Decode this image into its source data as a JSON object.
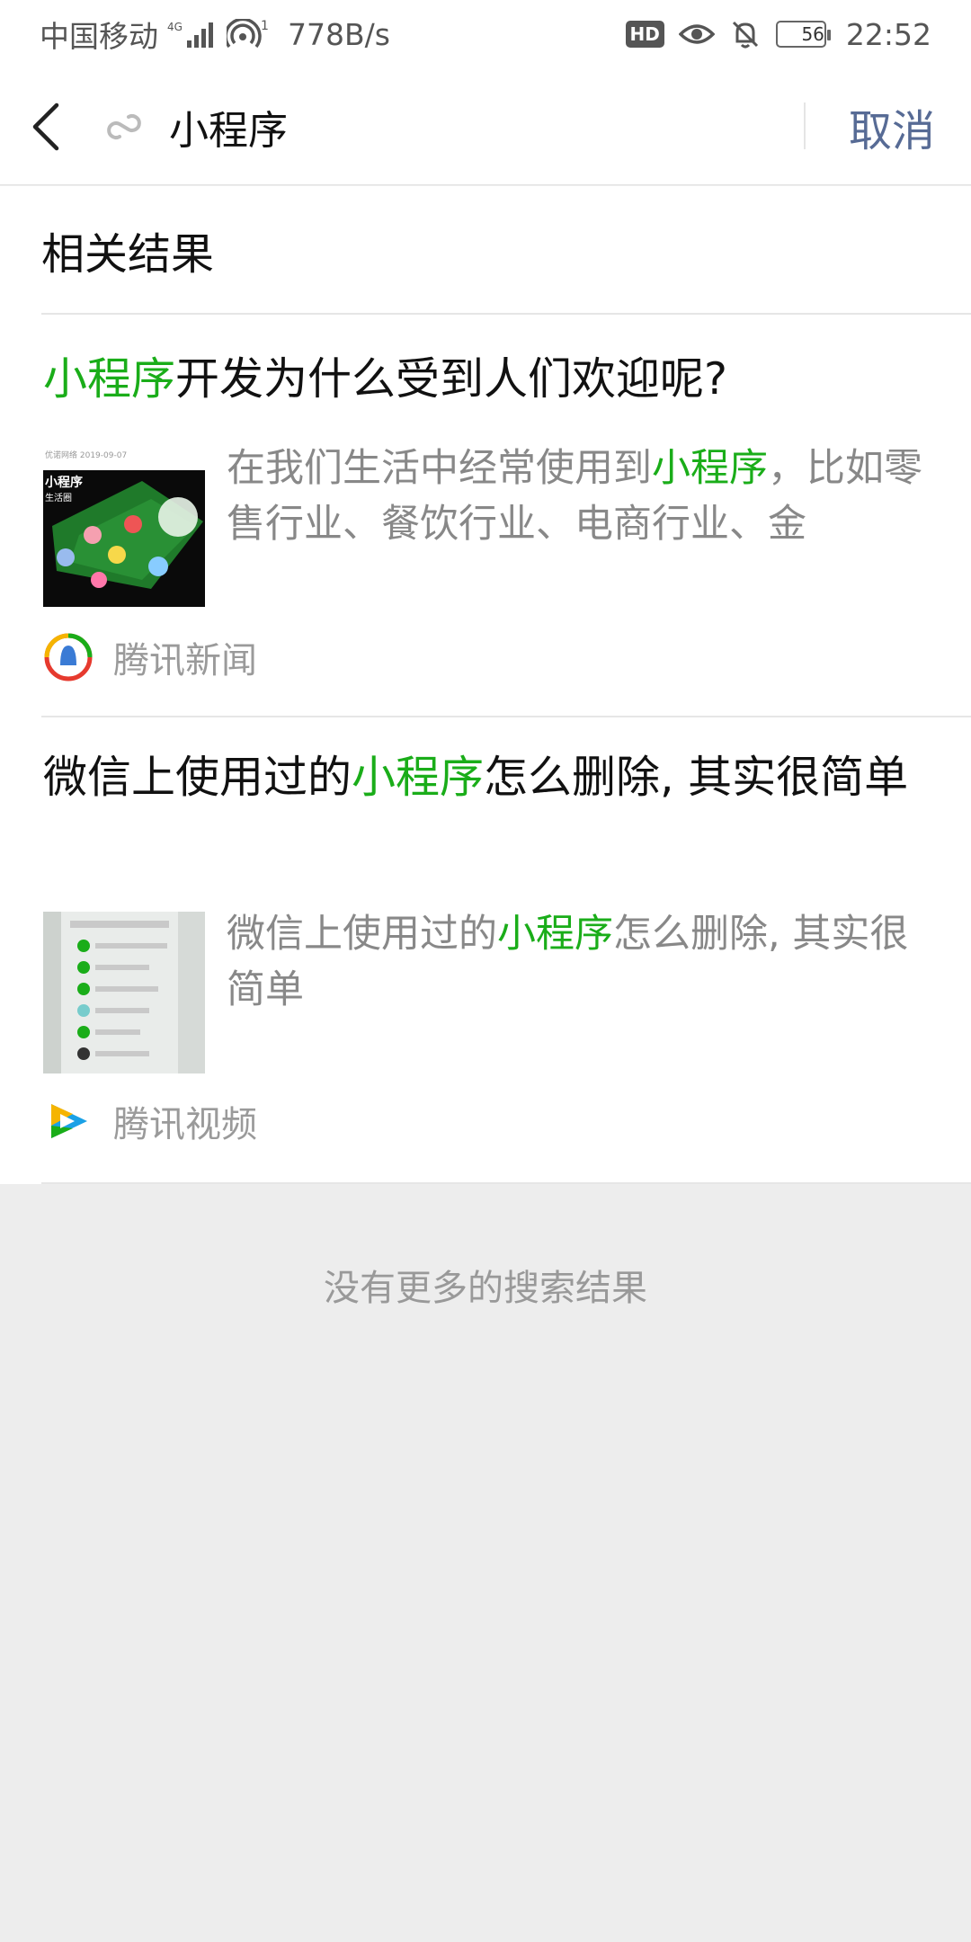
{
  "status_bar": {
    "carrier": "中国移动",
    "network": "4G",
    "hotspot_count": "1",
    "speed": "778B/s",
    "hd_badge": "HD",
    "battery": "56",
    "battery_level_percent": 56,
    "time": "22:52"
  },
  "search": {
    "query": "小程序",
    "cancel_label": "取消"
  },
  "section_title": "相关结果",
  "results": [
    {
      "title_pre": "",
      "title_hl": "小程序",
      "title_post": "开发为什么受到人们欢迎呢?",
      "thumb_date": "优诺网络 2019-09-07",
      "thumb_caption_1": "小程序",
      "thumb_caption_2": "生活圈",
      "snippet_pre": "在我们生活中经常使用到",
      "snippet_hl": "小程序",
      "snippet_post": "，比如零售行业、餐饮行业、电商行业、金",
      "source": "腾讯新闻"
    },
    {
      "title_pre": "微信上使用过的",
      "title_hl": "小程序",
      "title_post": "怎么删除, 其实很简单",
      "snippet_pre": "微信上使用过的",
      "snippet_hl": "小程序",
      "snippet_post": "怎么删除, 其实很简单",
      "source": "腾讯视频"
    }
  ],
  "footer": {
    "no_more": "没有更多的搜索结果"
  },
  "colors": {
    "highlight": "#1aad19",
    "cancel": "#576b95",
    "page_bg": "#ededed"
  },
  "icons": [
    "back-arrow-icon",
    "mini-program-icon",
    "tencent-news-logo-icon",
    "tencent-video-logo-icon",
    "hotspot-icon",
    "eye-icon",
    "bell-off-icon",
    "signal-icon"
  ]
}
